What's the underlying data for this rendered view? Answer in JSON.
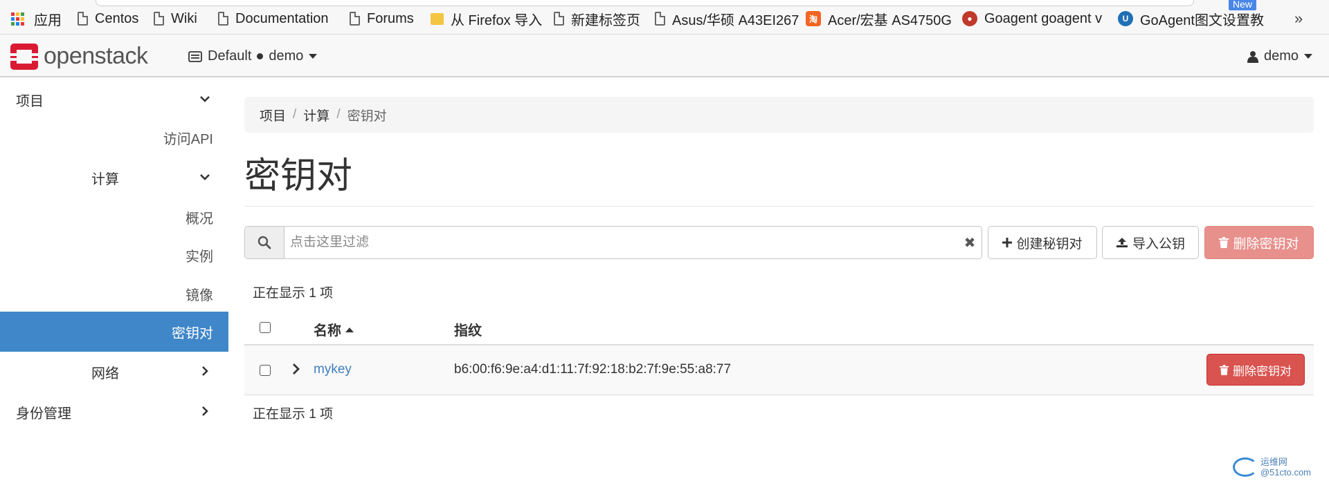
{
  "browser": {
    "bookmarks": [
      {
        "label": "应用",
        "icon": "apps-grid-icon"
      },
      {
        "label": "Centos",
        "icon": "document-icon"
      },
      {
        "label": "Wiki",
        "icon": "document-icon"
      },
      {
        "label": "Documentation",
        "icon": "document-icon"
      },
      {
        "label": "Forums",
        "icon": "document-icon"
      },
      {
        "label": "从 Firefox 导入",
        "icon": "folder-icon"
      },
      {
        "label": "新建标签页",
        "icon": "document-icon"
      },
      {
        "label": "Asus/华硕 A43EI267",
        "icon": "document-icon"
      },
      {
        "label": "Acer/宏基 AS4750G",
        "icon": "taobao-icon"
      },
      {
        "label": "Goagent goagent v",
        "icon": "goagent-icon"
      },
      {
        "label": "GoAgent图文设置教",
        "icon": "goagent-guide-icon"
      }
    ],
    "new_badge": "New",
    "more_label": "»"
  },
  "navbar": {
    "brand": "openstack",
    "domain": "Default",
    "project": "demo",
    "user": "demo"
  },
  "sidebar": {
    "project": "项目",
    "api_access": "访问API",
    "compute": "计算",
    "overview": "概况",
    "instances": "实例",
    "images": "镜像",
    "key_pairs": "密钥对",
    "network": "网络",
    "identity": "身份管理"
  },
  "breadcrumb": {
    "items": [
      "项目",
      "计算",
      "密钥对"
    ],
    "separator": "/"
  },
  "page": {
    "title": "密钥对"
  },
  "toolbar": {
    "filter_placeholder": "点击这里过滤",
    "filter_value": "",
    "create_label": "创建秘钥对",
    "import_label": "导入公钥",
    "delete_label": "删除密钥对"
  },
  "table": {
    "count_top": "正在显示 1 项",
    "count_bottom": "正在显示 1 项",
    "columns": {
      "name": "名称",
      "fingerprint": "指纹"
    },
    "rows": [
      {
        "name": "mykey",
        "fingerprint": "b6:00:f6:9e:a4:d1:11:7f:92:18:b2:7f:9e:55:a8:77",
        "action_label": "删除密钥对"
      }
    ]
  },
  "watermark": {
    "line1": "运维网",
    "line2": "@51cto.com"
  },
  "colors": {
    "brand_red": "#da1a32",
    "active_nav": "#3f87c9",
    "link": "#3f7fbf",
    "danger": "#d9534f",
    "danger_disabled": "#e8908c"
  }
}
